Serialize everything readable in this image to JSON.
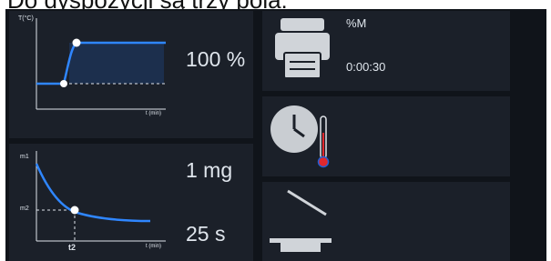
{
  "caption": "Do dyspozycji są trzy pola:",
  "left_panel": {
    "temp_chart": {
      "y_axis_label": "T(°C)",
      "x_axis_label": "t (min)",
      "value": "100 %"
    },
    "mass_chart": {
      "y_tick_1": "m1",
      "y_tick_2": "m2",
      "x_tick": "t2",
      "x_axis_label": "t (min)",
      "value_mass": "1 mg",
      "value_time": "25 s"
    }
  },
  "right_panel": {
    "print_field": {
      "icon": "printer-icon",
      "unit": "%M",
      "time": "0:00:30"
    },
    "time_temp_field": {
      "icon_clock": "clock-icon",
      "icon_thermo": "thermometer-icon"
    },
    "balance_field": {
      "icon": "pan-icon"
    }
  },
  "colors": {
    "curve": "#2f86ff",
    "background": "#10141a",
    "tile": "#1b2029"
  }
}
